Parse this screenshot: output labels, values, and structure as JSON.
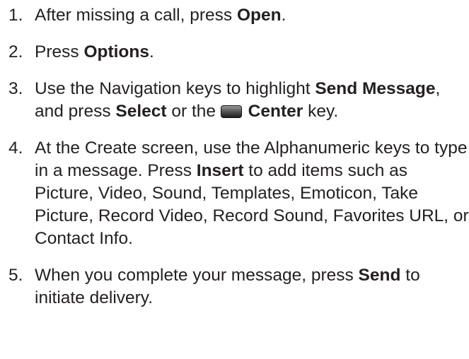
{
  "steps": [
    {
      "number": "1.",
      "t1": "After missing a call, press ",
      "b1": "Open",
      "t2": "."
    },
    {
      "number": "2.",
      "t1": "Press ",
      "b1": "Options",
      "t2": "."
    },
    {
      "number": "3.",
      "t1": "Use the Navigation keys to highlight ",
      "b1": "Send Message",
      "t2": ", and press ",
      "b2": "Select",
      "t3": " or the ",
      "icon": "center-key-icon",
      "b3": "Center",
      "t4": " key."
    },
    {
      "number": "4.",
      "t1": "At the Create screen, use the Alphanumeric keys to type in a message. Press ",
      "b1": "Insert",
      "t2": " to add items such as Picture, Video, Sound, Templates, Emoticon, Take Picture, Record Video, Record Sound, Favorites URL, or Contact Info."
    },
    {
      "number": "5.",
      "t1": "When you complete your message, press ",
      "b1": "Send",
      "t2": " to initiate delivery."
    }
  ]
}
